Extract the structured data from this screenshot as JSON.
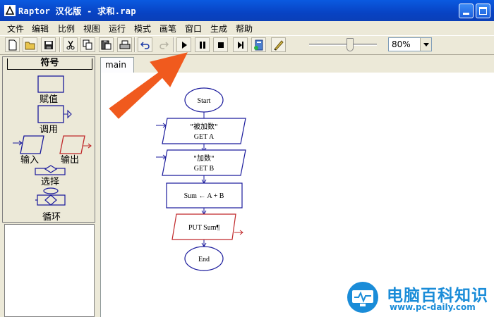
{
  "window": {
    "title": "Raptor 汉化版 - 求和.rap"
  },
  "menu": [
    "文件",
    "编辑",
    "比例",
    "视图",
    "运行",
    "模式",
    "画笔",
    "窗口",
    "生成",
    "帮助"
  ],
  "toolbar": {
    "buttons": [
      "new-icon",
      "open-icon",
      "save-icon",
      "cut-icon",
      "copy-icon",
      "paste-icon",
      "print-icon",
      "undo-icon",
      "redo-icon",
      "play-icon",
      "pause-icon",
      "stop-icon",
      "step-icon",
      "test-icon",
      "pen-icon"
    ],
    "zoom": "80%",
    "speed_fraction": 0.56
  },
  "symbols": {
    "header": "符号",
    "assign": "赋值",
    "call": "调用",
    "input": "输入",
    "output": "输出",
    "selection": "选择",
    "loop": "循环"
  },
  "tab": {
    "label": "main"
  },
  "flowchart": {
    "start": "Start",
    "input1_prompt": "\"被加数\"",
    "input1_get": "GET A",
    "input2_prompt": "\"加数\"",
    "input2_get": "GET B",
    "assign": "Sum ← A + B",
    "output": "PUT Sum¶",
    "end": "End"
  },
  "watermark": {
    "title": "电脑百科知识",
    "url": "www.pc-daily.com"
  },
  "colors": {
    "arrow": "#f05a1e",
    "flow_shape": "#1a1a9c",
    "output_shape": "#c0282a",
    "watermark": "#1a8cd8"
  }
}
